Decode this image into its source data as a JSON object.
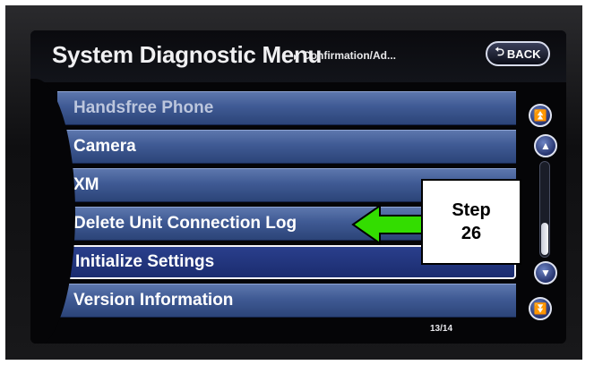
{
  "header": {
    "title": "System Diagnostic Menu",
    "breadcrumb_separator": "▸",
    "breadcrumb": "Confirmation/Ad...",
    "back_icon": "back-arrow-icon",
    "back_label": "BACK"
  },
  "menu": {
    "items": [
      {
        "label": "Handsfree Phone"
      },
      {
        "label": "Camera"
      },
      {
        "label": "XM"
      },
      {
        "label": "Delete Unit Connection Log"
      },
      {
        "label": "Initialize Settings"
      },
      {
        "label": "Version Information"
      }
    ],
    "selected_label": "Initialize Settings"
  },
  "scroll": {
    "page_indicator": "13/14",
    "icons": [
      "page-top-icon",
      "scroll-up-icon",
      "scroll-down-icon",
      "page-bottom-icon"
    ]
  },
  "annotation": {
    "line1": "Step",
    "line2": "26",
    "arrow_color": "#33dd00"
  },
  "colors": {
    "row_blue": "#3f5a94",
    "selected_row": "#1b2c6f",
    "screen_bg": "#050507"
  }
}
